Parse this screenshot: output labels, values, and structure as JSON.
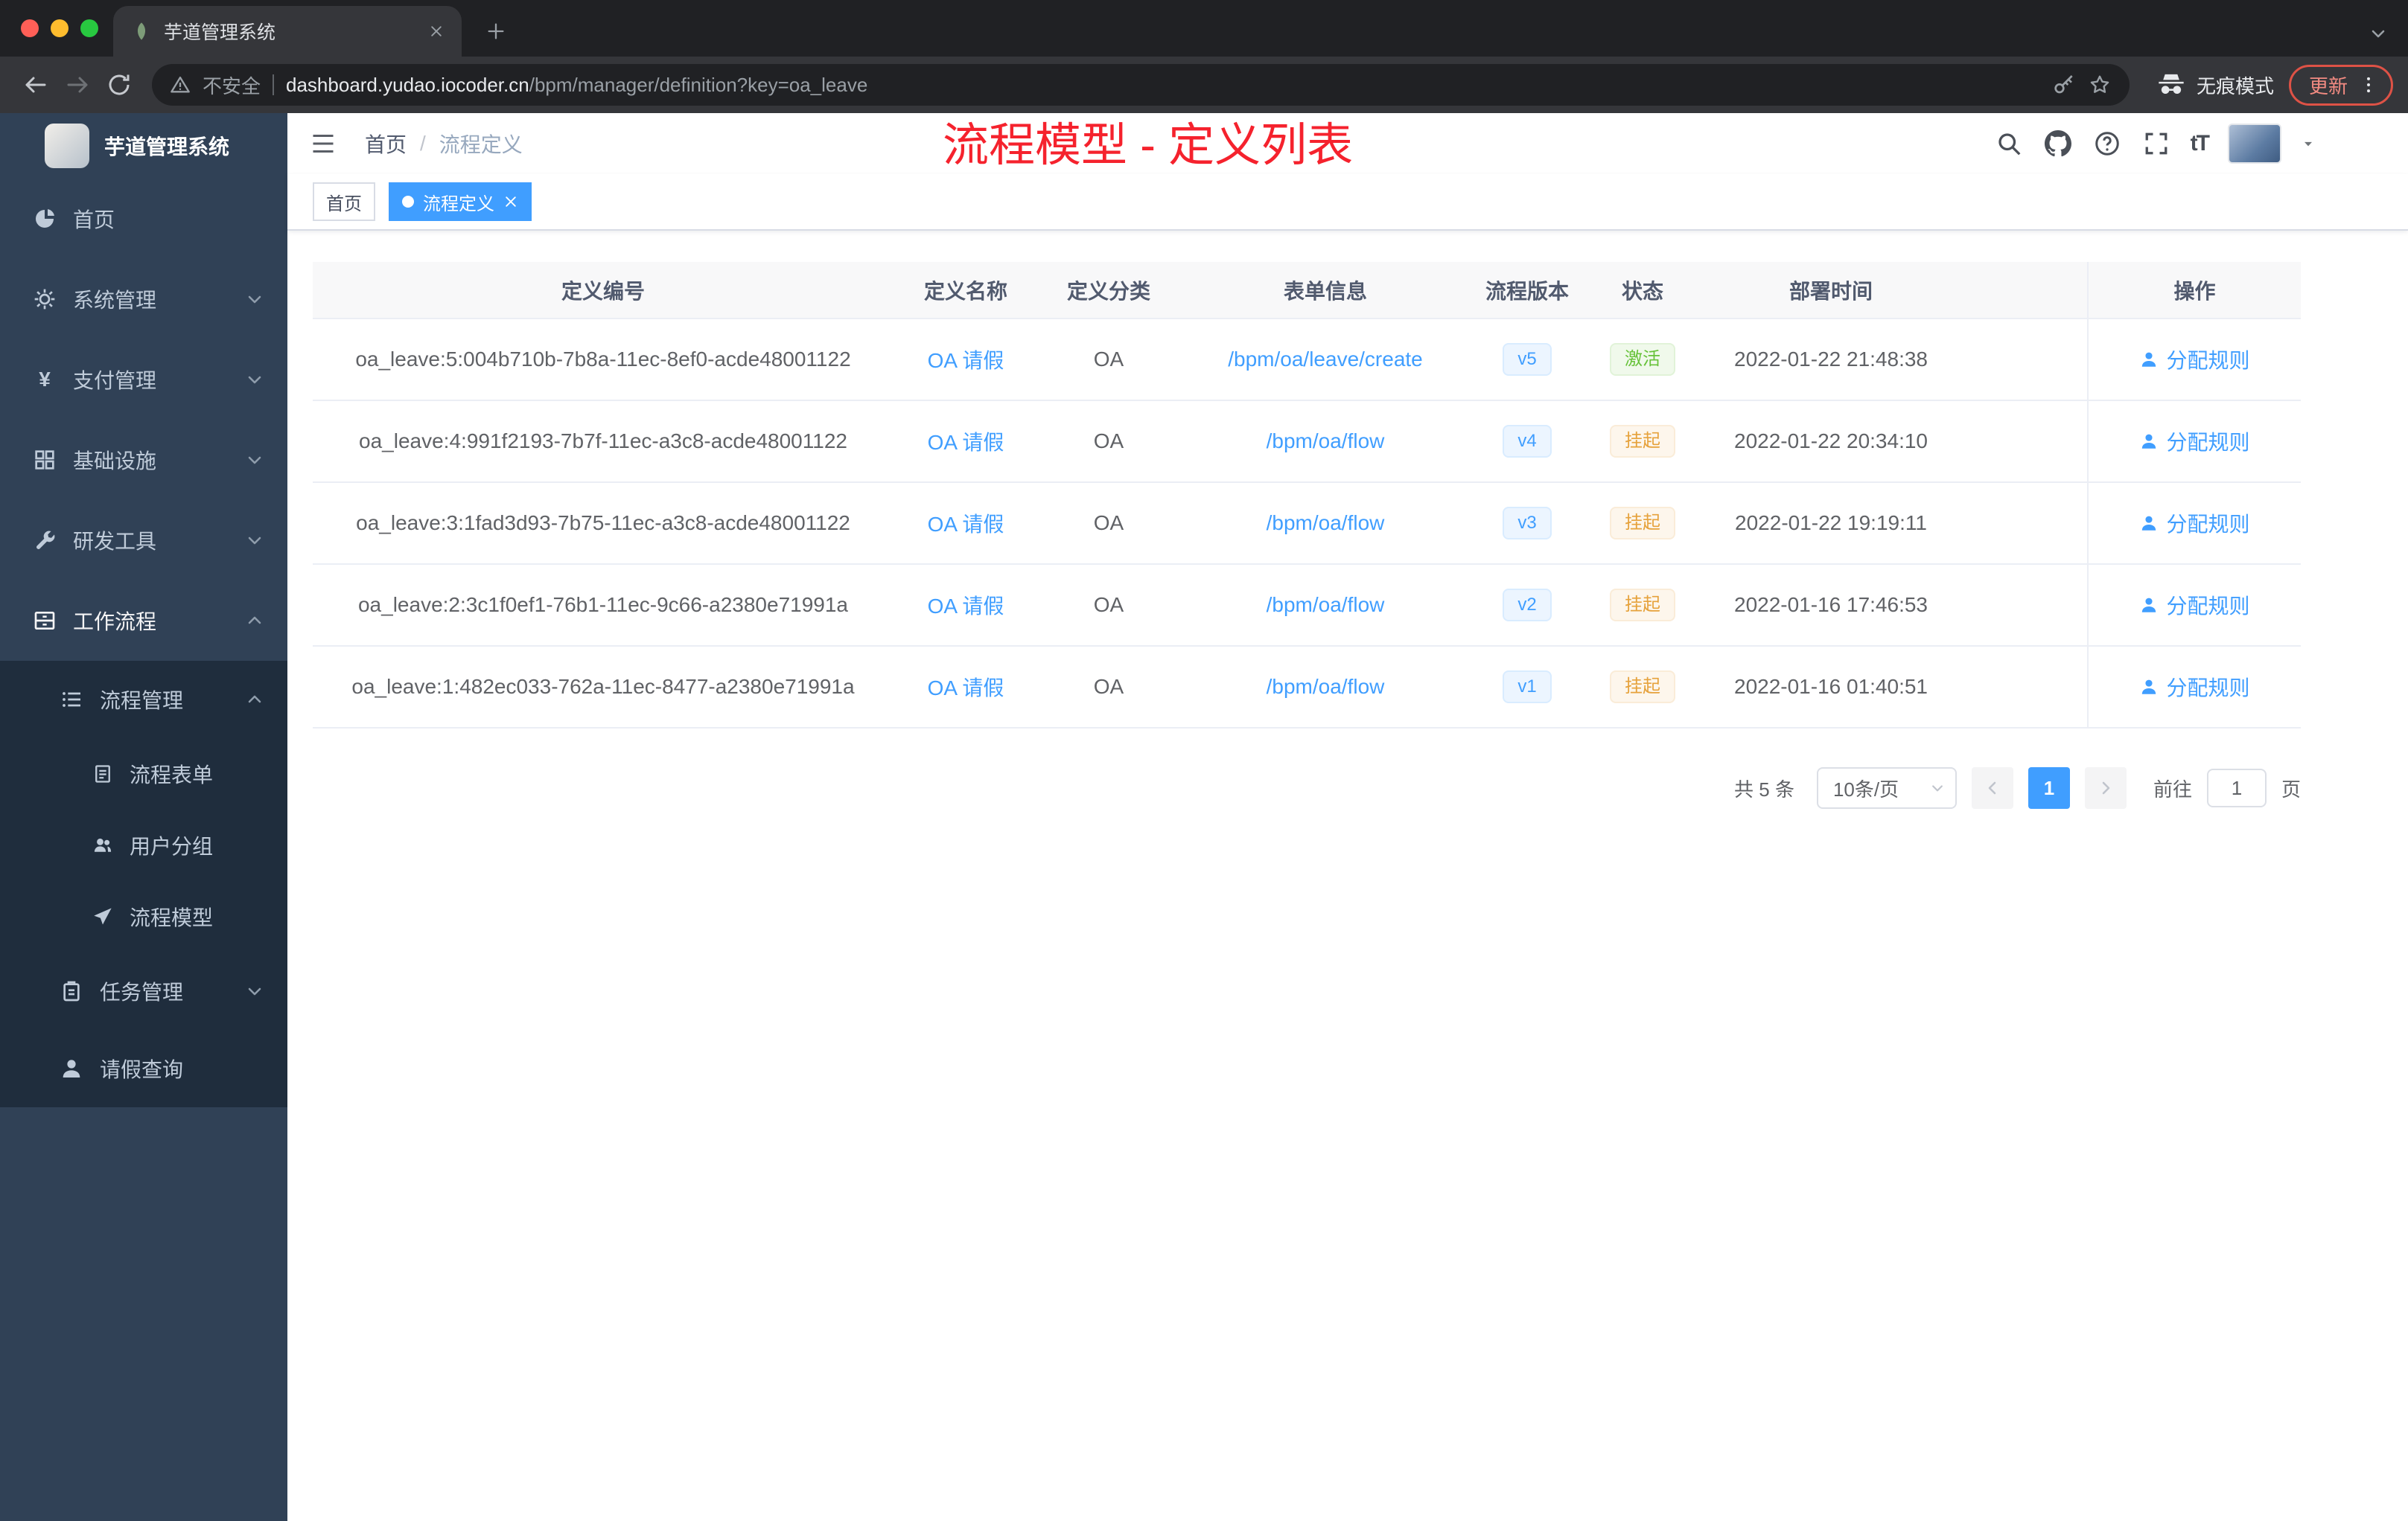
{
  "colors": {
    "accent": "#409eff",
    "page_title_red": "#f5222d",
    "status_success": "#67c23a",
    "status_warning": "#e6a23c",
    "sidebar_bg": "#304156",
    "submenu_bg": "#1f2d3d"
  },
  "browser": {
    "tab_title": "芋道管理系统",
    "security_label": "不安全",
    "url_domain": "dashboard.yudao.iocoder.cn",
    "url_path": "/bpm/manager/definition?key=oa_leave",
    "incognito_label": "无痕模式",
    "update_label": "更新"
  },
  "icons": {
    "yen_glyph": "¥",
    "font_size_glyph": "tT"
  },
  "sidebar": {
    "brand": "芋道管理系统",
    "items": [
      "首页",
      "系统管理",
      "支付管理",
      "基础设施",
      "研发工具",
      "工作流程",
      "流程管理",
      "流程表单",
      "用户分组",
      "流程模型",
      "任务管理",
      "请假查询"
    ]
  },
  "header": {
    "breadcrumb_home": "首页",
    "breadcrumb_sep": "/",
    "breadcrumb_current": "流程定义",
    "title": "流程模型 - 定义列表"
  },
  "tags": {
    "home": "首页",
    "active": "流程定义"
  },
  "table": {
    "columns": [
      "定义编号",
      "定义名称",
      "定义分类",
      "表单信息",
      "流程版本",
      "状态",
      "部署时间",
      "操作"
    ],
    "rows": [
      {
        "id": "oa_leave:5:004b710b-7b8a-11ec-8ef0-acde48001122",
        "name": "OA 请假",
        "category": "OA",
        "form": "/bpm/oa/leave/create",
        "version": "v5",
        "status": "激活",
        "time": "2022-01-22 21:48:38",
        "action": "分配规则"
      },
      {
        "id": "oa_leave:4:991f2193-7b7f-11ec-a3c8-acde48001122",
        "name": "OA 请假",
        "category": "OA",
        "form": "/bpm/oa/flow",
        "version": "v4",
        "status": "挂起",
        "time": "2022-01-22 20:34:10",
        "action": "分配规则"
      },
      {
        "id": "oa_leave:3:1fad3d93-7b75-11ec-a3c8-acde48001122",
        "name": "OA 请假",
        "category": "OA",
        "form": "/bpm/oa/flow",
        "version": "v3",
        "status": "挂起",
        "time": "2022-01-22 19:19:11",
        "action": "分配规则"
      },
      {
        "id": "oa_leave:2:3c1f0ef1-76b1-11ec-9c66-a2380e71991a",
        "name": "OA 请假",
        "category": "OA",
        "form": "/bpm/oa/flow",
        "version": "v2",
        "status": "挂起",
        "time": "2022-01-16 17:46:53",
        "action": "分配规则"
      },
      {
        "id": "oa_leave:1:482ec033-762a-11ec-8477-a2380e71991a",
        "name": "OA 请假",
        "category": "OA",
        "form": "/bpm/oa/flow",
        "version": "v1",
        "status": "挂起",
        "time": "2022-01-16 01:40:51",
        "action": "分配规则"
      }
    ]
  },
  "pagination": {
    "total": "共 5 条",
    "page_size": "10条/页",
    "current": "1",
    "goto_label": "前往",
    "goto_value": "1",
    "page_unit": "页"
  }
}
